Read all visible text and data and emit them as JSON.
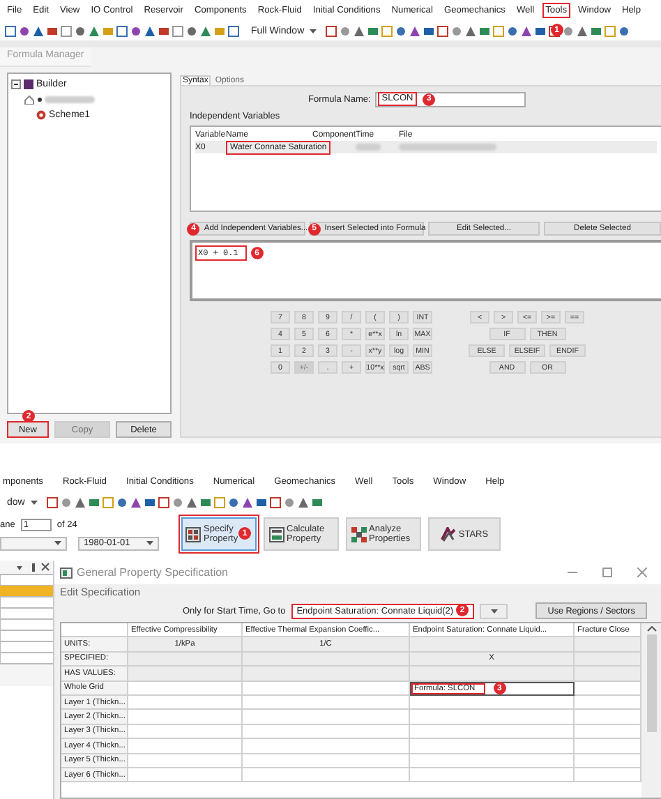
{
  "top": {
    "menu": [
      {
        "label": "File"
      },
      {
        "label": "Edit"
      },
      {
        "label": "View"
      },
      {
        "label": "IO Control"
      },
      {
        "label": "Reservoir"
      },
      {
        "label": "Components"
      },
      {
        "label": "Rock-Fluid"
      },
      {
        "label": "Initial Conditions"
      },
      {
        "label": "Numerical"
      },
      {
        "label": "Geomechanics"
      },
      {
        "label": "Well"
      },
      {
        "label": "Tools",
        "highlighted": true,
        "badge": "1"
      },
      {
        "label": "Window"
      },
      {
        "label": "Help"
      }
    ],
    "view_select": "Full Window",
    "formula_manager": {
      "title": "Formula Manager",
      "tree": [
        {
          "label": "Builder",
          "kind": "root",
          "expanded": true,
          "children": [
            {
              "kind": "redacted",
              "children": [
                {
                  "label": "Scheme1",
                  "kind": "formula"
                }
              ]
            }
          ]
        }
      ],
      "buttons": [
        {
          "label": "New",
          "disabled": false,
          "highlighted": true,
          "badge": "2"
        },
        {
          "label": "Copy",
          "disabled": true,
          "highlighted": false
        },
        {
          "label": "Delete",
          "disabled": false,
          "highlighted": false
        }
      ],
      "tabs": [
        {
          "label": "Syntax",
          "selected": true
        },
        {
          "label": "Options",
          "selected": false
        }
      ],
      "formula_name": {
        "label": "Formula Name:",
        "value": "SLCON",
        "highlighted": true,
        "badge": "3"
      },
      "variables": {
        "title": "Independent Variables",
        "columns": [
          "Variable",
          "Name",
          "Component",
          "Time",
          "File"
        ],
        "rows": [
          {
            "variable": "X0",
            "name": "Water Connate Saturation",
            "name_highlighted": true,
            "time_redacted": true,
            "file_redacted": true
          }
        ]
      },
      "actions": [
        {
          "label": "Add Independent Variables...",
          "badge": "4"
        },
        {
          "label": "Insert Selected into Formula",
          "badge": "5"
        },
        {
          "label": "Edit Selected..."
        },
        {
          "label": "Delete Selected"
        }
      ],
      "formula": {
        "text": "X0 + 0.1",
        "highlighted": true,
        "badge": "6"
      },
      "keypad_left": [
        [
          {
            "label": "7"
          },
          {
            "label": "8"
          },
          {
            "label": "9"
          },
          {
            "label": "/"
          },
          {
            "label": "("
          },
          {
            "label": ")"
          },
          {
            "label": "INT"
          }
        ],
        [
          {
            "label": "4"
          },
          {
            "label": "5"
          },
          {
            "label": "6"
          },
          {
            "label": "*"
          },
          {
            "label": "e**x"
          },
          {
            "label": "ln"
          },
          {
            "label": "MAX"
          }
        ],
        [
          {
            "label": "1"
          },
          {
            "label": "2"
          },
          {
            "label": "3"
          },
          {
            "label": "-"
          },
          {
            "label": "x**y"
          },
          {
            "label": "log"
          },
          {
            "label": "MIN"
          }
        ],
        [
          {
            "label": "0"
          },
          {
            "label": "+/-",
            "disabled": true
          },
          {
            "label": "."
          },
          {
            "label": "+"
          },
          {
            "label": "10**x"
          },
          {
            "label": "sqrt"
          },
          {
            "label": "ABS"
          }
        ]
      ],
      "keypad_right": [
        [
          "<",
          ">",
          "<=",
          ">=",
          "=="
        ],
        [
          "IF",
          "THEN"
        ],
        [
          "ELSE",
          "ELSEIF",
          "ENDIF"
        ],
        [
          "AND",
          "OR"
        ]
      ]
    }
  },
  "bottom": {
    "menu": [
      {
        "label": "mponents"
      },
      {
        "label": "Rock-Fluid"
      },
      {
        "label": "Initial Conditions"
      },
      {
        "label": "Numerical"
      },
      {
        "label": "Geomechanics"
      },
      {
        "label": "Well"
      },
      {
        "label": "Tools"
      },
      {
        "label": "Window"
      },
      {
        "label": "Help"
      }
    ],
    "view_select": "dow",
    "plane": {
      "label": "ane",
      "value": "1",
      "total": "of 24"
    },
    "date": "1980-01-01",
    "big_buttons": [
      {
        "label": "Specify Property",
        "kind": "specify",
        "highlighted": true,
        "badge": "1"
      },
      {
        "label": "Calculate Property",
        "kind": "calculate",
        "highlighted": false
      },
      {
        "label": "Analyze Properties",
        "kind": "analyze",
        "highlighted": false
      },
      {
        "label": "STARS",
        "kind": "stars",
        "highlighted": false
      }
    ],
    "dialog": {
      "title": "General Property Specification",
      "section": "Edit Specification",
      "goto_label": "Only for Start Time, Go to",
      "goto_value": "Endpoint Saturation: Connate Liquid(2)",
      "goto_highlighted": true,
      "goto_badge": "2",
      "regions_button": "Use Regions / Sectors",
      "columns": [
        "Effective Compressibility",
        "Effective Thermal Expansion Coeffic...",
        "Endpoint Saturation: Connate Liquid...",
        "Fracture Close"
      ],
      "rows": [
        {
          "label": "UNITS:",
          "kind": "info",
          "cells": [
            "1/kPa",
            "1/C",
            null,
            null
          ]
        },
        {
          "label": "SPECIFIED:",
          "kind": "info",
          "cells": [
            null,
            null,
            "X",
            null
          ]
        },
        {
          "label": "HAS VALUES:",
          "kind": "info",
          "cells": [
            null,
            null,
            null,
            null
          ]
        },
        {
          "label": "Whole Grid",
          "kind": "data",
          "cells": [
            null,
            null,
            "Formula: SLCON",
            null
          ],
          "editing": true,
          "highlighted": true,
          "badge": "3"
        },
        {
          "label": "Layer 1 (Thickn...",
          "kind": "data",
          "cells": [
            null,
            null,
            null,
            null
          ]
        },
        {
          "label": "Layer 2 (Thickn...",
          "kind": "data",
          "cells": [
            null,
            null,
            null,
            null
          ]
        },
        {
          "label": "Layer 3 (Thickn...",
          "kind": "data",
          "cells": [
            null,
            null,
            null,
            null
          ]
        },
        {
          "label": "Layer 4 (Thickn...",
          "kind": "data",
          "cells": [
            null,
            null,
            null,
            null
          ]
        },
        {
          "label": "Layer 5 (Thickn...",
          "kind": "data",
          "cells": [
            null,
            null,
            null,
            null
          ]
        },
        {
          "label": "Layer 6 (Thickn...",
          "kind": "data",
          "cells": [
            null,
            null,
            null,
            null
          ]
        }
      ]
    }
  }
}
